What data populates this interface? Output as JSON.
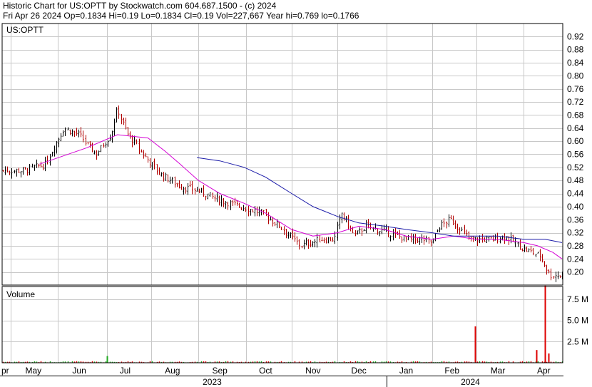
{
  "header": {
    "line1": "Historic Chart for US:OPTT by Stockwatch.com 604.687.1500 - (c) 2024",
    "line2": "Fri Apr 26 2024   Op=0.1834   Hi=0.19   Lo=0.1834   Cl=0.19   Vol=227,667   Year hi=0.769   lo=0.1766"
  },
  "colors": {
    "grid": "#c8c8c8",
    "frame": "#000000",
    "up_bar": "#000000",
    "down_bar": "#b00000",
    "ma_short": "#d400d4",
    "ma_long": "#1a1aa8",
    "vol_up": "#22aa22",
    "vol_down": "#dd0000"
  },
  "chart_data": [
    {
      "type": "line",
      "title": "US:OPTT",
      "y_ticks": [
        "0.20",
        "0.24",
        "0.28",
        "0.32",
        "0.36",
        "0.40",
        "0.44",
        "0.48",
        "0.52",
        "0.56",
        "0.60",
        "0.64",
        "0.68",
        "0.72",
        "0.76",
        "0.80",
        "0.84",
        "0.88",
        "0.92"
      ],
      "ylim": [
        0.16,
        0.96
      ],
      "x_labels": [
        "pr",
        "May",
        "Jun",
        "Jul",
        "Aug",
        "Sep",
        "Oct",
        "Nov",
        "Dec",
        "Jan",
        "Feb",
        "Mar",
        "Apr"
      ],
      "year_labels": [
        "2023",
        "2024"
      ],
      "grid": true,
      "price_path": {
        "x": [
          "2023-04-26",
          "2023-05-10",
          "2023-05-24",
          "2023-06-05",
          "2023-06-15",
          "2023-06-26",
          "2023-07-06",
          "2023-07-10",
          "2023-07-17",
          "2023-07-27",
          "2023-08-07",
          "2023-08-21",
          "2023-08-31",
          "2023-09-15",
          "2023-09-29",
          "2023-10-13",
          "2023-10-27",
          "2023-11-07",
          "2023-11-20",
          "2023-11-29",
          "2023-12-04",
          "2023-12-12",
          "2023-12-20",
          "2024-01-03",
          "2024-01-16",
          "2024-01-26",
          "2024-02-01",
          "2024-02-06",
          "2024-02-13",
          "2024-02-26",
          "2024-03-11",
          "2024-03-20",
          "2024-04-01",
          "2024-04-12",
          "2024-04-18",
          "2024-04-26"
        ],
        "y": [
          0.51,
          0.51,
          0.53,
          0.64,
          0.62,
          0.56,
          0.62,
          0.7,
          0.62,
          0.56,
          0.5,
          0.46,
          0.45,
          0.42,
          0.4,
          0.38,
          0.33,
          0.28,
          0.3,
          0.3,
          0.38,
          0.31,
          0.34,
          0.32,
          0.3,
          0.3,
          0.29,
          0.34,
          0.36,
          0.3,
          0.3,
          0.31,
          0.27,
          0.25,
          0.19,
          0.19
        ]
      },
      "series": [
        {
          "name": "",
          "color_key": "ma_short",
          "x": [
            "2023-05-20",
            "2023-06-20",
            "2023-07-10",
            "2023-07-30",
            "2023-08-10",
            "2023-08-20",
            "2023-09-01",
            "2023-09-15",
            "2023-10-01",
            "2023-10-15",
            "2023-11-01",
            "2023-11-15",
            "2023-12-01",
            "2023-12-15",
            "2024-01-01",
            "2024-01-15",
            "2024-02-01",
            "2024-02-15",
            "2024-03-01",
            "2024-03-15",
            "2024-04-01",
            "2024-04-10",
            "2024-04-20",
            "2024-04-26"
          ],
          "y": [
            0.53,
            0.58,
            0.62,
            0.61,
            0.57,
            0.53,
            0.48,
            0.44,
            0.41,
            0.38,
            0.33,
            0.31,
            0.32,
            0.34,
            0.33,
            0.31,
            0.3,
            0.31,
            0.3,
            0.3,
            0.29,
            0.28,
            0.26,
            0.24
          ]
        },
        {
          "name": "",
          "color_key": "ma_long",
          "x": [
            "2023-08-31",
            "2023-09-15",
            "2023-10-01",
            "2023-10-15",
            "2023-11-01",
            "2023-11-15",
            "2023-12-01",
            "2023-12-15",
            "2024-01-01",
            "2024-01-15",
            "2024-02-01",
            "2024-02-15",
            "2024-03-01",
            "2024-03-15",
            "2024-04-01",
            "2024-04-15",
            "2024-04-26"
          ],
          "y": [
            0.55,
            0.54,
            0.52,
            0.49,
            0.44,
            0.4,
            0.37,
            0.35,
            0.34,
            0.33,
            0.32,
            0.31,
            0.31,
            0.31,
            0.3,
            0.3,
            0.29
          ]
        }
      ]
    },
    {
      "type": "bar",
      "title": "Volume",
      "y_ticks": [
        "2.5 M",
        "5.0 M",
        "7.5 M"
      ],
      "ylim": [
        0,
        9.0
      ],
      "x": [
        "2023-07-03",
        "2024-02-29",
        "2024-04-09",
        "2024-04-15",
        "2024-04-17"
      ],
      "values": [
        0.8,
        4.3,
        1.5,
        9.1,
        1.1
      ],
      "baseline_millions": 0.12
    }
  ]
}
